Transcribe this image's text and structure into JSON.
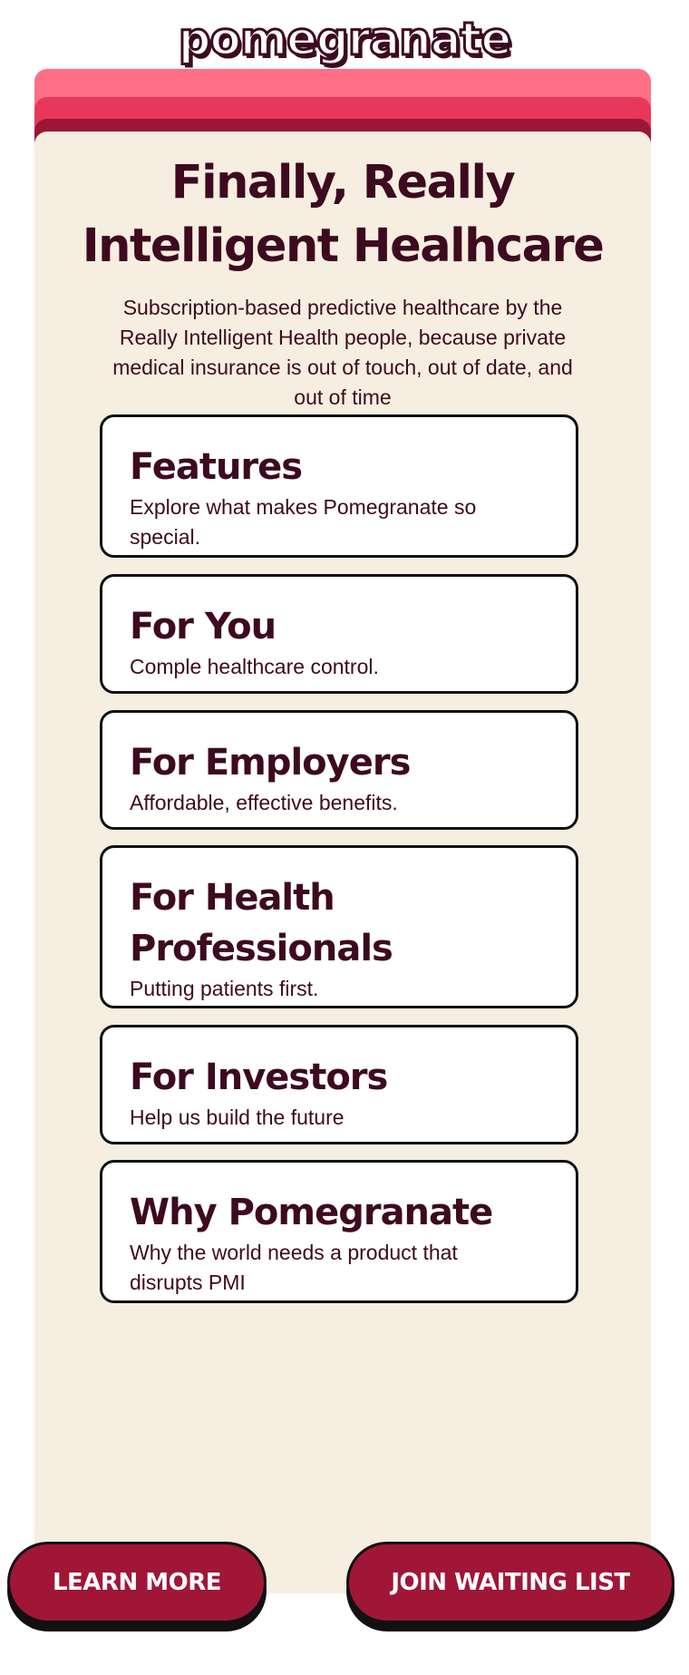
{
  "brand": {
    "logo_text": "pomegranate"
  },
  "hero": {
    "title_line1": "Finally, Really",
    "title_line2": "Intelligent Healhcare",
    "subtitle": "Subscription-based predictive healthcare by the Really Intelligent Health people, because private medical insurance is out of touch, out of date, and out of time"
  },
  "cards": [
    {
      "title": "Features",
      "description": "Explore what makes Pomegranate so special."
    },
    {
      "title": "For You",
      "description": "Comple healthcare control."
    },
    {
      "title": "For Employers",
      "description": "Affordable, effective benefits."
    },
    {
      "title": "For Health Professionals",
      "description": "Putting patients first."
    },
    {
      "title": "For Investors",
      "description": "Help us build the future"
    },
    {
      "title": "Why Pomegranate",
      "description": "Why the world needs a product that disrupts PMI"
    }
  ],
  "actions": {
    "learn_more": "LEARN MORE",
    "join_waiting_list": "JOIN WAITING LIST"
  },
  "colors": {
    "brand_dark": "#3d0a1f",
    "button": "#a01637",
    "panel": "#f6eee0",
    "band_light": "#ff6f86",
    "band_mid": "#e8385a",
    "band_dark": "#9c1637"
  }
}
